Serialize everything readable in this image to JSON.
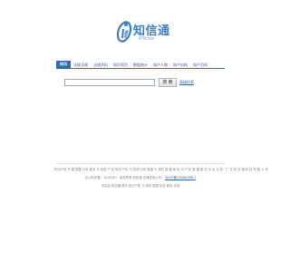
{
  "logo": {
    "name": "知信通",
    "sub": "iPRnow"
  },
  "nav": {
    "items": [
      {
        "label": "知讯",
        "active": true
      },
      {
        "label": "法规法规"
      },
      {
        "label": "法规资料"
      },
      {
        "label": "知识项目"
      },
      {
        "label": "数据统计"
      },
      {
        "label": "知产人物"
      },
      {
        "label": "知产机构"
      },
      {
        "label": "知产百科"
      }
    ]
  },
  "search": {
    "value": "",
    "placeholder": "",
    "button_label": "搜 索",
    "advanced_label": "高级检索"
  },
  "footer": {
    "line1": "知识产权 专 题 数据 分析 服务 与 双语 产 权 知识 产权 与 双语 分析 数据 与 资料 数 据 库 知 识 产 权 数 据 服 务 平 台 分 析 · 广 东 知 信 通 科 技 有 限 公 司",
    "line2_text": "京公网安备：11010502 · 版权所有 知信通 法律咨询公司：",
    "line2_link": "京ICP备12345678号-2",
    "line3": "本站由 知信通 提供 知识产权 与 相关 数据 信息 服务 支持"
  }
}
